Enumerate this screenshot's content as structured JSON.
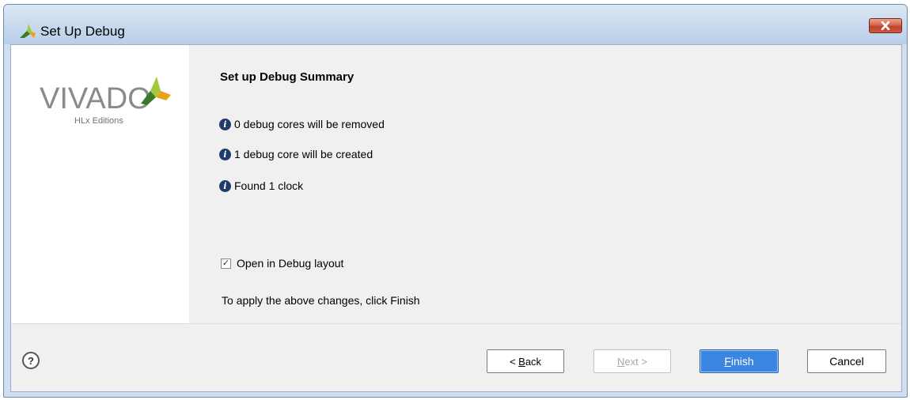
{
  "window": {
    "title": "Set Up Debug"
  },
  "sidebar": {
    "logo_text": "VIVADO",
    "logo_subtext": "HLx Editions"
  },
  "summary": {
    "heading": "Set up Debug Summary",
    "lines": [
      "0 debug cores will be removed",
      "1 debug core will be created",
      "Found 1 clock"
    ],
    "checkbox_label": "Open in Debug layout",
    "checkbox_checked": true,
    "hint": "To apply the above changes, click Finish"
  },
  "footer": {
    "help_label": "?",
    "back": {
      "prefix": "< ",
      "mnemonic": "B",
      "rest": "ack"
    },
    "next": {
      "mnemonic": "N",
      "rest": "ext >",
      "enabled": false
    },
    "finish": {
      "mnemonic": "F",
      "rest": "inish"
    },
    "cancel": "Cancel"
  },
  "colors": {
    "finish_button": "#3c86e2",
    "info_icon": "#1f3a6b",
    "close_button": "#c0432b"
  }
}
